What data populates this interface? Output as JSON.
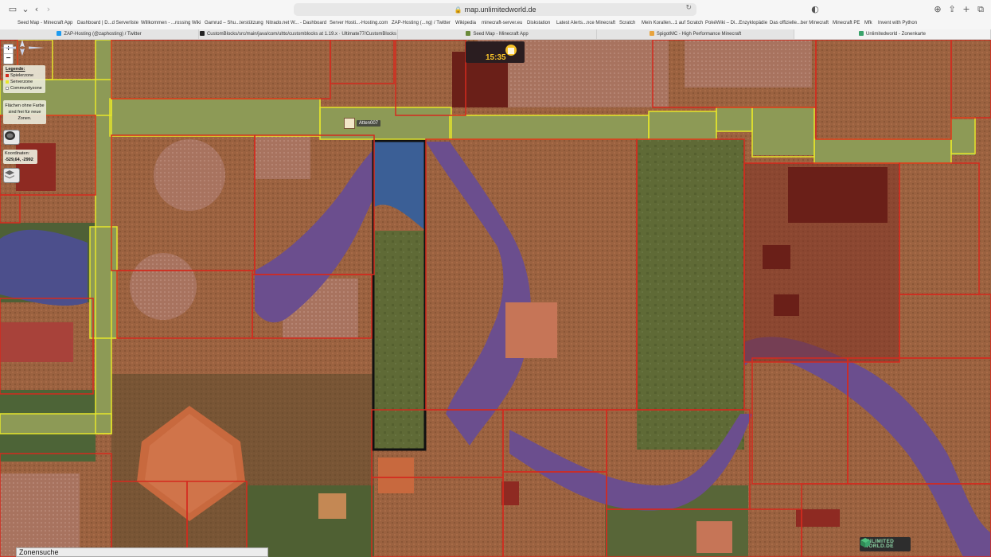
{
  "browser": {
    "address": "map.unlimitedworld.de",
    "bookmarks": [
      "Seed Map - Minecraft App",
      "Dashboard | D...d Serverliste",
      "Willkommen - ...rossing Wiki",
      "Gamrud – Shu...terstützung",
      "Nitrado.net W... - Dashboard",
      "Server Hosti...-Hosting.com",
      "ZAP-Hosting (...ng) / Twitter",
      "Wikipedia",
      "minecraft-server.eu",
      "Diskstation",
      "Latest Alerts...nce Minecraft",
      "Scratch",
      "Mein Korallen...1 auf Scratch",
      "PokéWiki – Di...Enzyklopädie",
      "Das offizielle...ber Minecraft",
      "Minecraft PE",
      "Mfk",
      "Invent with Python"
    ],
    "tabs": [
      {
        "label": "ZAP-Hosting (@zaphosting) / Twitter",
        "color": "#1d9bf0"
      },
      {
        "label": "CustomBlocks/src/main/java/com/ultto/customblocks at 1.19.x · Ultimate77/CustomBlocks",
        "color": "#222222"
      },
      {
        "label": "Seed Map - Minecraft App",
        "color": "#6a8a3a"
      },
      {
        "label": "SpigotMC - High Performance Minecraft",
        "color": "#e8a33d"
      },
      {
        "label": "Unlimitedworld - Zonenkarte",
        "color": "#3aa36b"
      }
    ],
    "active_tab": 4
  },
  "map": {
    "zoom_in": "+",
    "zoom_out": "−",
    "legend": {
      "title": "Legende:",
      "items": [
        {
          "label": "Spielerzone",
          "color": "#d42a1e"
        },
        {
          "label": "Serverzone",
          "color": "#e6e62a"
        },
        {
          "label": "Communityzone",
          "color": "#ffffff"
        }
      ]
    },
    "hint": "Flächen ohne Farbe sind frei für neue Zonen.",
    "coords_label": "Koordinaten:",
    "coords_value": "-529,64, -2992",
    "clock": "15:35",
    "player_name": "Atten007",
    "zone_search": "Zonensuche",
    "brand": [
      "UNLIMITED",
      "WORLD.DE"
    ],
    "colors": {
      "player_zone": "#d42a1e",
      "server_zone": "#e6e62a",
      "terrain": "#9b6240",
      "grass": "#5f6a36",
      "water": "#6b4e8e",
      "path": "#b7a67e"
    }
  }
}
